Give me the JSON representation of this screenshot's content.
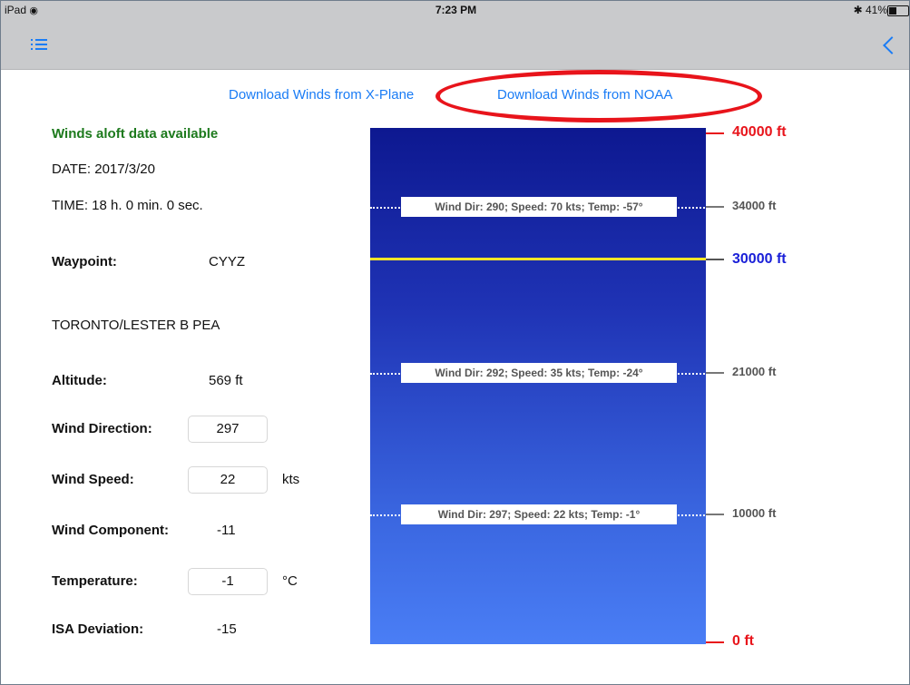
{
  "status_bar": {
    "device": "iPad",
    "time": "7:23 PM",
    "battery": "41%",
    "battery_level": 0.41
  },
  "nav": {
    "list_icon": "list-icon",
    "back_icon": "chevron-left-icon"
  },
  "downloads": {
    "xplane_label": "Download Winds from X-Plane",
    "noaa_label": "Download Winds from NOAA"
  },
  "info": {
    "availability": "Winds aloft data available",
    "date": "DATE: 2017/3/20",
    "time": "TIME: 18 h. 0 min. 0 sec.",
    "waypoint_label": "Waypoint:",
    "waypoint_value": "CYYZ",
    "airport_name": "TORONTO/LESTER B PEA",
    "altitude_label": "Altitude:",
    "altitude_value": "569 ft",
    "wind_direction_label": "Wind Direction:",
    "wind_direction_value": "297",
    "wind_speed_label": "Wind Speed:",
    "wind_speed_value": "22",
    "wind_speed_unit": "kts",
    "wind_component_label": "Wind Component:",
    "wind_component_value": "-11",
    "temperature_label": "Temperature:",
    "temperature_value": "-1",
    "temperature_unit": "°C",
    "isa_label": "ISA Deviation:",
    "isa_value": "-15"
  },
  "altitude_scale": {
    "top": "40000 ft",
    "bottom": "0 ft",
    "selected": "30000 ft",
    "levels": [
      {
        "label": "34000 ft",
        "wind": "Wind Dir: 290; Speed: 70 kts; Temp: -57°"
      },
      {
        "label": "21000 ft",
        "wind": "Wind Dir: 292; Speed: 35 kts; Temp: -24°"
      },
      {
        "label": "10000 ft",
        "wind": "Wind Dir: 297; Speed: 22 kts; Temp: -1°"
      }
    ]
  },
  "colors": {
    "accent": "#1a7cf5",
    "limit": "#e8141b",
    "selected": "#1a20d8",
    "available": "#1d7a1d",
    "cruise_line": "#ffe629"
  }
}
